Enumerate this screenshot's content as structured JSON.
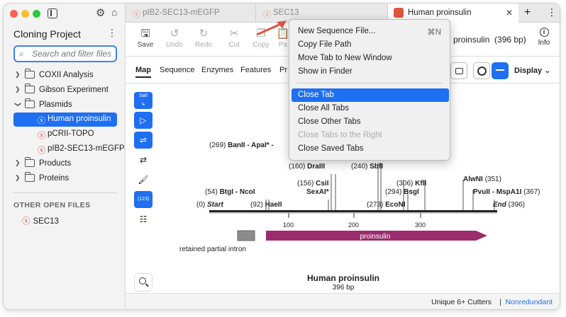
{
  "sidebar": {
    "project_title": "Cloning Project",
    "search_placeholder": "Search and filter files",
    "tree": [
      {
        "label": "COXII Analysis"
      },
      {
        "label": "Gibson Experiment"
      },
      {
        "label": "Plasmids"
      },
      {
        "label": "Human proinsulin"
      },
      {
        "label": "pCRII-TOPO"
      },
      {
        "label": "pIB2-SEC13-mEGFP"
      },
      {
        "label": "Products"
      },
      {
        "label": "Proteins"
      }
    ],
    "other_title": "OTHER OPEN FILES",
    "other_files": [
      {
        "label": "SEC13"
      }
    ]
  },
  "tabs": [
    {
      "label": "pIB2-SEC13-mEGFP"
    },
    {
      "label": "SEC13"
    },
    {
      "label": "Human proinsulin"
    }
  ],
  "toolbar": {
    "save": "Save",
    "undo": "Undo",
    "redo": "Redo",
    "cut": "Cut",
    "copy": "Copy",
    "paste": "Pa",
    "sequence_title": "n proinsulin",
    "sequence_len": "(396 bp)",
    "info": "Info"
  },
  "subtabs": [
    {
      "label": "Map"
    },
    {
      "label": "Sequence"
    },
    {
      "label": "Enzymes"
    },
    {
      "label": "Features"
    },
    {
      "label": "Pr"
    }
  ],
  "display_label": "Display",
  "context_menu": [
    {
      "label": "New Sequence File...",
      "shortcut": "⌘N"
    },
    {
      "label": "Copy File Path"
    },
    {
      "label": "Move Tab to New Window"
    },
    {
      "label": "Show in Finder"
    },
    {
      "label": "Close Tab"
    },
    {
      "label": "Close All Tabs"
    },
    {
      "label": "Close Other Tabs"
    },
    {
      "label": "Close Tabs to the Right"
    },
    {
      "label": "Close Saved Tabs"
    }
  ],
  "lefttools": {
    "sali": "SalI",
    "count": "(123)"
  },
  "map": {
    "sites": [
      {
        "pos": "(269)",
        "name": "BanII - ApaI*",
        "suffix": " -"
      },
      {
        "pos": "(160)",
        "name": "DraIII"
      },
      {
        "pos": "(240)",
        "name": "SbfI"
      },
      {
        "pos": "(156)",
        "name": "CsiI"
      },
      {
        "name": "SexAI*"
      },
      {
        "pos": "(306)",
        "name": "KflI"
      },
      {
        "pos": "(294)",
        "name": "BsgI"
      },
      {
        "name": "AlwNI",
        "pos": "(351)"
      },
      {
        "pos": "(54)",
        "name": "BtgI - NcoI"
      },
      {
        "pos": "(92)",
        "name": "HaeII"
      },
      {
        "pos": "(273)",
        "name": "EcoNI"
      },
      {
        "name": "PvuII - MspA1I",
        "pos": "(367)"
      },
      {
        "pos": "(0)",
        "name": "Start"
      },
      {
        "name": "End",
        "pos": "(396)"
      }
    ],
    "ticks": [
      "100",
      "200",
      "300"
    ],
    "features": [
      {
        "label": "retained partial intron"
      },
      {
        "label": "proinsulin"
      }
    ],
    "plasmid_name": "Human proinsulin",
    "plasmid_len": "396 bp"
  },
  "status": {
    "left": "Unique 6+ Cutters",
    "sep": "|",
    "right": "Nonredundant"
  },
  "colors": {
    "accent": "#1e6ff2",
    "feature": "#9b2d6f",
    "intron": "#8c8c8c",
    "arrow": "#e0553f"
  }
}
